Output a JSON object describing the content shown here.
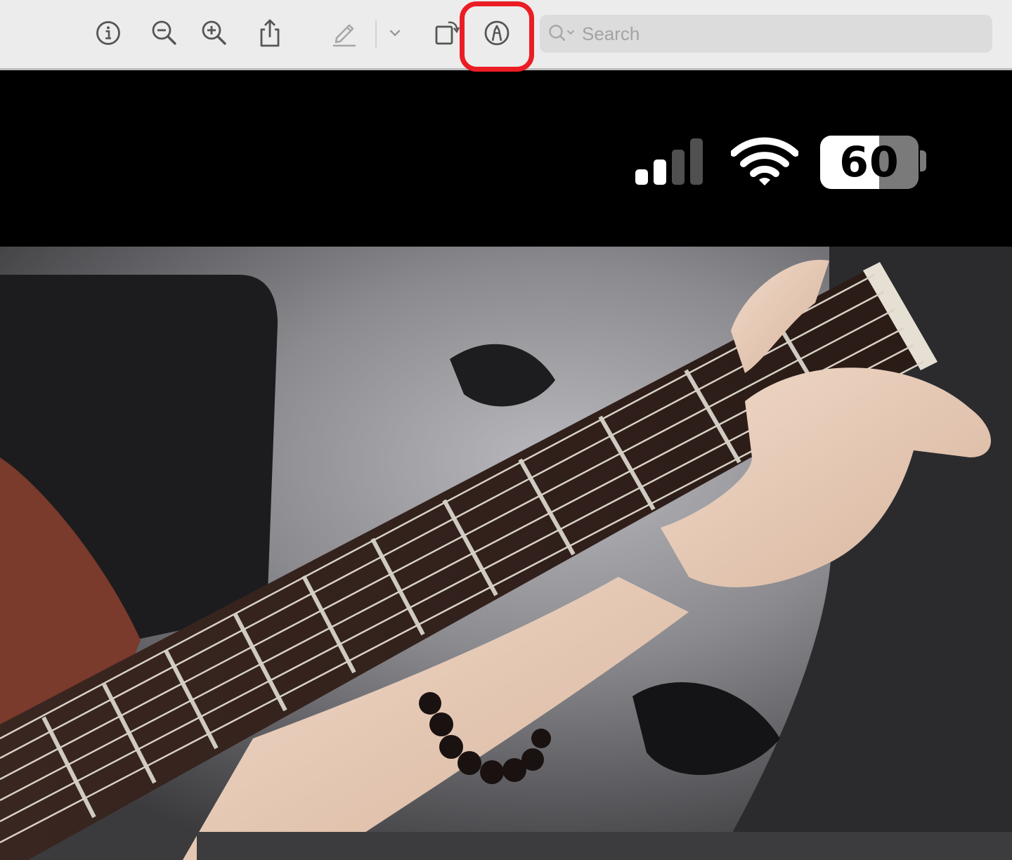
{
  "toolbar": {
    "buttons": [
      {
        "name": "info",
        "icon": "info-icon"
      },
      {
        "name": "zoom-out",
        "icon": "zoom-out-icon"
      },
      {
        "name": "zoom-in",
        "icon": "zoom-in-icon"
      },
      {
        "name": "share",
        "icon": "share-icon"
      },
      {
        "name": "markup-pen",
        "icon": "pencil-icon"
      },
      {
        "name": "markup-dropdown",
        "icon": "chevron-down-icon"
      },
      {
        "name": "rotate",
        "icon": "rotate-icon"
      },
      {
        "name": "markup-toolbar",
        "icon": "markup-pen-circle-icon",
        "highlighted": true
      }
    ],
    "highlight_color": "#ec1c24",
    "search": {
      "placeholder": "Search",
      "value": "",
      "icon": "search-icon"
    }
  },
  "status_bar": {
    "signal_bars": 4,
    "signal_active_bars": 2,
    "wifi_icon": "wifi-icon",
    "battery_percent": 60,
    "battery_label": "60"
  },
  "photo": {
    "subject": "guitar-fretboard-photo"
  }
}
